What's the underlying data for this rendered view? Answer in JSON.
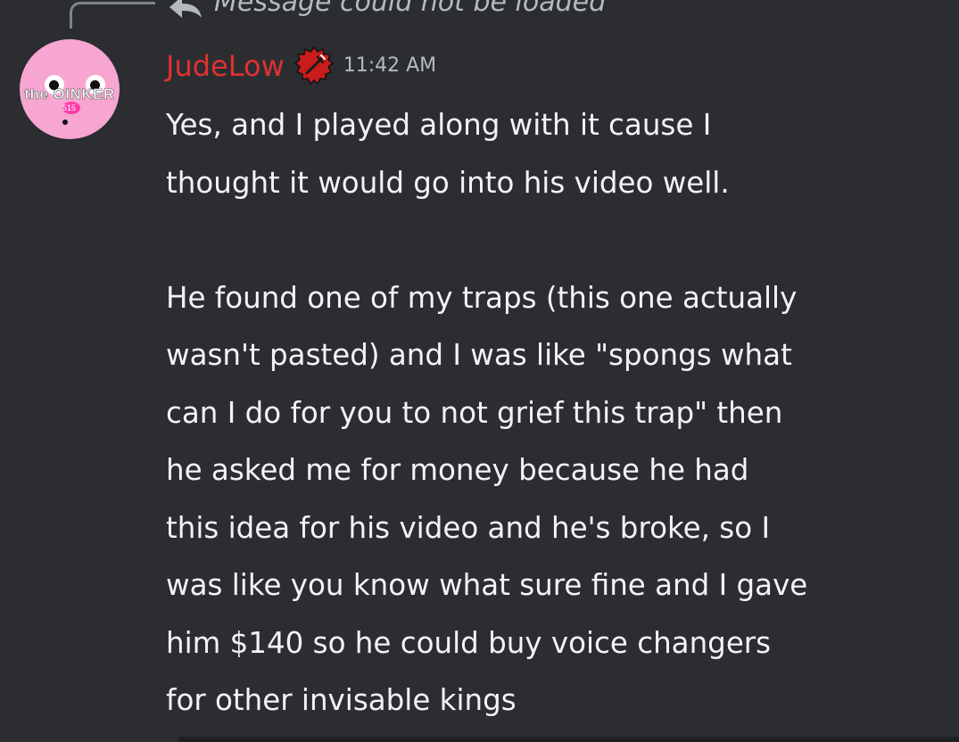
{
  "reply": {
    "text": "Message could not be loaded",
    "icon": "reply-arrow-icon"
  },
  "author": {
    "avatar_text": "the OINKER",
    "avatar_subtext": "515",
    "username": "JudeLow",
    "username_color": "#e03131",
    "badge_icon": "role-badge-icon",
    "timestamp": "11:42 AM"
  },
  "message": {
    "paragraph_1": "Yes, and I played along with it cause I\nthought it would go into his video well.",
    "paragraph_2": "He found one of my traps (this one actually\nwasn't pasted) and I was like \"spongs what\ncan I do for you to not grief this trap\" then\nhe asked me for money because he had\nthis idea for his video and he's broke, so I\nwas like you know what sure fine and I gave\nhim $140 so he could buy voice changers\nfor other invisable kings"
  },
  "colors": {
    "background": "#2b2d31",
    "text": "#f2f3f5",
    "muted": "#b5bac1",
    "avatar_bg": "#f6a6d0"
  }
}
